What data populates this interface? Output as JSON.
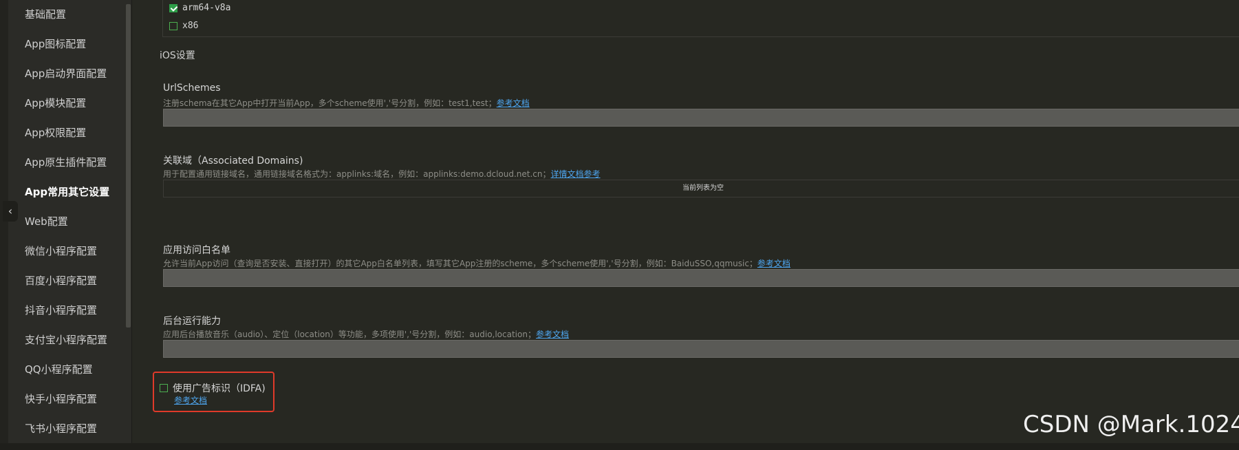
{
  "sidebar": {
    "items": [
      {
        "label": "基础配置"
      },
      {
        "label": "App图标配置"
      },
      {
        "label": "App启动界面配置"
      },
      {
        "label": "App模块配置"
      },
      {
        "label": "App权限配置"
      },
      {
        "label": "App原生插件配置"
      },
      {
        "label": "App常用其它设置",
        "active": true
      },
      {
        "label": "Web配置"
      },
      {
        "label": "微信小程序配置"
      },
      {
        "label": "百度小程序配置"
      },
      {
        "label": "抖音小程序配置"
      },
      {
        "label": "支付宝小程序配置"
      },
      {
        "label": "QQ小程序配置"
      },
      {
        "label": "快手小程序配置"
      },
      {
        "label": "飞书小程序配置"
      }
    ],
    "collapse_icon": "chevron-left-icon"
  },
  "arch": {
    "options": [
      {
        "label": "arm64-v8a",
        "checked": true
      },
      {
        "label": "x86",
        "checked": false
      }
    ]
  },
  "ios": {
    "section_title": "iOS设置",
    "url_schemes": {
      "label": "UrlSchemes",
      "hint": "注册schema在其它App中打开当前App，多个scheme使用','号分割，例如：test1,test；",
      "link": "参考文档"
    },
    "associated_domains": {
      "label": "关联域（Associated Domains)",
      "hint": "用于配置通用链接域名，通用链接域名格式为：applinks:域名，例如：applinks:demo.dcloud.net.cn；",
      "link": "详情文档参考",
      "empty_text": "当前列表为空"
    },
    "whitelist": {
      "label": "应用访问白名单",
      "hint": "允许当前App访问（查询是否安装、直接打开）的其它App白名单列表，填写其它App注册的scheme，多个scheme使用','号分割，例如：BaiduSSO,qqmusic；",
      "link": "参考文档"
    },
    "background": {
      "label": "后台运行能力",
      "hint": "应用后台播放音乐（audio）、定位（location）等功能，多项使用','号分割，例如：audio,location；",
      "link": "参考文档"
    },
    "idfa": {
      "label": "使用广告标识（IDFA)",
      "checked": false,
      "link": "参考文档"
    }
  },
  "watermark": "CSDN @Mark.1024",
  "colors": {
    "background": "#272822",
    "link": "#4ea6f0",
    "highlight_border": "#e03a2a",
    "checkbox": "#2e9e48"
  }
}
